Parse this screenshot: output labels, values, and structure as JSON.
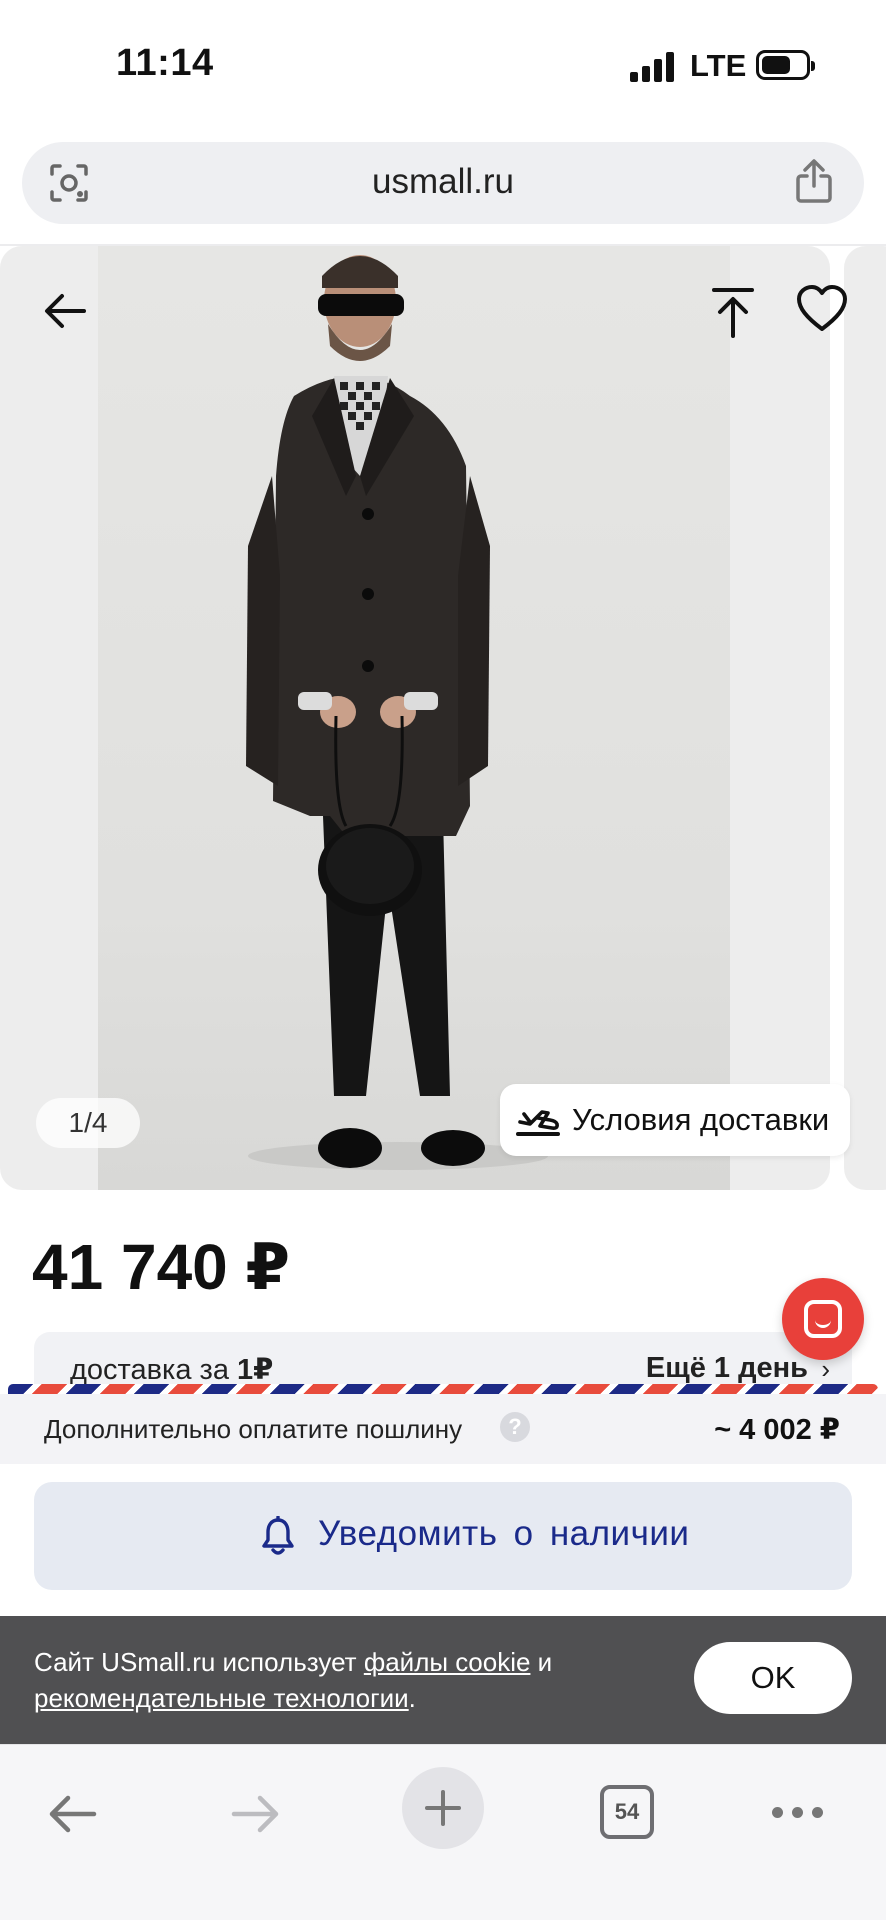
{
  "status_bar": {
    "time": "11:14",
    "network": "LTE"
  },
  "browser": {
    "url": "usmall.ru",
    "tab_count": "54"
  },
  "gallery": {
    "counter": "1/4",
    "delivery_conditions_label": "Условия доставки"
  },
  "product": {
    "price": "41 740 ₽"
  },
  "delivery": {
    "prefix": "доставка за ",
    "price": "1₽",
    "extra_days": "Ещё 1 день",
    "chevron": "›"
  },
  "duty": {
    "label": "Дополнительно оплатите пошлину",
    "help": "?",
    "value": "~ 4 002 ₽"
  },
  "notify": {
    "label": "Уведомить о наличии"
  },
  "cookie_banner": {
    "text_before": "Сайт USmall.ru использует ",
    "link_cookies": "файлы cookie",
    "text_middle": " и ",
    "link_recommend": "рекомендательные технологии",
    "text_after": ".",
    "ok_label": "OK"
  },
  "colors": {
    "accent_red": "#e8403a",
    "notify_text": "#1a2a8a",
    "notify_bg": "#e6eaf2"
  },
  "icons": [
    "camera-lens-icon",
    "share-icon",
    "back-arrow-icon",
    "scroll-to-top-icon",
    "heart-icon",
    "airplane-icon",
    "chat-icon",
    "bell-icon",
    "nav-back-icon",
    "nav-forward-icon",
    "new-tab-icon",
    "tabs-icon",
    "more-icon"
  ]
}
